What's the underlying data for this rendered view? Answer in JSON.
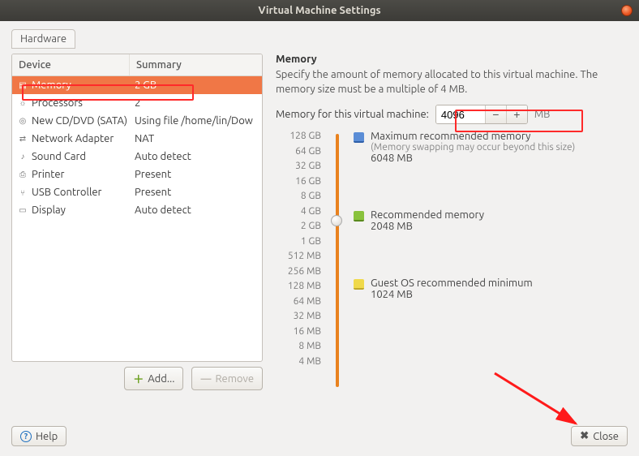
{
  "window": {
    "title": "Virtual Machine Settings"
  },
  "tabs": {
    "hardware": "Hardware"
  },
  "table": {
    "headers": {
      "device": "Device",
      "summary": "Summary"
    },
    "rows": [
      {
        "icon": "memory-icon",
        "glyph": "▤",
        "device": "Memory",
        "summary": "2 GB",
        "selected": true
      },
      {
        "icon": "processors-icon",
        "glyph": "☼",
        "device": "Processors",
        "summary": "2"
      },
      {
        "icon": "cd-icon",
        "glyph": "◎",
        "device": "New CD/DVD (SATA)",
        "summary": "Using file /home/lin/Dow"
      },
      {
        "icon": "network-icon",
        "glyph": "⇄",
        "device": "Network Adapter",
        "summary": "NAT"
      },
      {
        "icon": "sound-icon",
        "glyph": "♪",
        "device": "Sound Card",
        "summary": "Auto detect"
      },
      {
        "icon": "printer-icon",
        "glyph": "⎙",
        "device": "Printer",
        "summary": "Present"
      },
      {
        "icon": "usb-icon",
        "glyph": "⑂",
        "device": "USB Controller",
        "summary": "Present"
      },
      {
        "icon": "display-icon",
        "glyph": "▭",
        "device": "Display",
        "summary": "Auto detect"
      }
    ]
  },
  "left_buttons": {
    "add": "Add...",
    "remove": "Remove"
  },
  "memory": {
    "heading": "Memory",
    "description": "Specify the amount of memory allocated to this virtual machine. The memory size must be a multiple of 4 MB.",
    "field_label": "Memory for this virtual machine:",
    "value": "4096",
    "unit": "MB",
    "ticks": [
      "128 GB",
      "64 GB",
      "32 GB",
      "16 GB",
      "8 GB",
      "4 GB",
      "2 GB",
      "1 GB",
      "512 MB",
      "256 MB",
      "128 MB",
      "64 MB",
      "32 MB",
      "16 MB",
      "8 MB",
      "4 MB"
    ],
    "thumb_index": 5,
    "legend": {
      "max": {
        "title": "Maximum recommended memory",
        "note": "(Memory swapping may occur beyond this size)",
        "value": "6048 MB"
      },
      "rec": {
        "title": "Recommended memory",
        "value": "2048 MB"
      },
      "min": {
        "title": "Guest OS recommended minimum",
        "value": "1024 MB"
      }
    }
  },
  "footer": {
    "help": "Help",
    "close": "Close"
  }
}
